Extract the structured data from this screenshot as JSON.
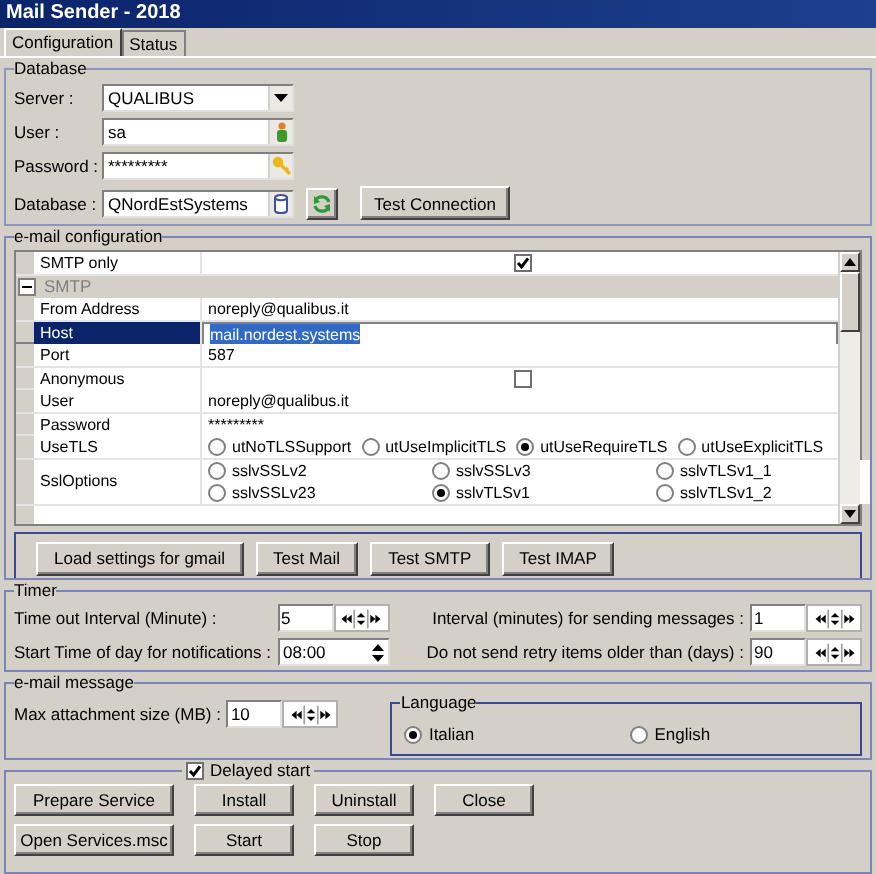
{
  "window": {
    "title": "Mail Sender - 2018"
  },
  "tabs": [
    {
      "label": "Configuration",
      "selected": true
    },
    {
      "label": "Status",
      "selected": false
    }
  ],
  "database": {
    "title": "Database",
    "fields": [
      {
        "label": "Server :",
        "value": "QUALIBUS",
        "kind": "dropdown"
      },
      {
        "label": "User :",
        "value": "sa",
        "kind": "user"
      },
      {
        "label": "Password :",
        "value": "*********",
        "kind": "password"
      },
      {
        "label": "Database :",
        "value": "QNordEstSystems",
        "kind": "database"
      }
    ],
    "test_button": "Test Connection"
  },
  "email_configuration": {
    "title": "e-mail configuration",
    "rows": [
      {
        "kind": "check",
        "label": "SMTP only",
        "checked": true
      },
      {
        "kind": "category",
        "label": "SMTP",
        "expanded": true
      },
      {
        "kind": "text",
        "label": "From Address",
        "value": "noreply@qualibus.it"
      },
      {
        "kind": "text",
        "label": "Host",
        "value": "mail.nordest.systems",
        "selected": true
      },
      {
        "kind": "text",
        "label": "Port",
        "value": "587"
      },
      {
        "kind": "check",
        "label": "Anonymous",
        "checked": false
      },
      {
        "kind": "text",
        "label": "User",
        "value": "noreply@qualibus.it"
      },
      {
        "kind": "text",
        "label": "Password",
        "value": "*********"
      },
      {
        "kind": "radio",
        "label": "UseTLS",
        "options": [
          {
            "label": "utNoTLSSupport",
            "selected": false
          },
          {
            "label": "utUseImplicitTLS",
            "selected": false
          },
          {
            "label": "utUseRequireTLS",
            "selected": true
          },
          {
            "label": "utUseExplicitTLS",
            "selected": false
          }
        ]
      },
      {
        "kind": "radio",
        "label": "SslOptions",
        "options": [
          {
            "label": "sslvSSLv2",
            "selected": false
          },
          {
            "label": "sslvSSLv3",
            "selected": false
          },
          {
            "label": "sslvTLSv1_1",
            "selected": false
          },
          {
            "label": "sslvSSLv23",
            "selected": false
          },
          {
            "label": "sslvTLSv1",
            "selected": true
          },
          {
            "label": "sslvTLSv1_2",
            "selected": false
          }
        ]
      }
    ],
    "buttons": [
      "Load settings for gmail",
      "Test Mail",
      "Test SMTP",
      "Test IMAP"
    ]
  },
  "timer": {
    "title": "Timer",
    "fields": [
      {
        "label": "Time out Interval (Minute) :",
        "value": "5",
        "kind": "spin"
      },
      {
        "label": "Interval (minutes) for sending messages :",
        "value": "1",
        "kind": "spin"
      },
      {
        "label": "Start Time of day for notifications :",
        "value": "08:00",
        "kind": "time"
      },
      {
        "label": "Do not send retry items older than (days) :",
        "value": "90",
        "kind": "spin"
      }
    ]
  },
  "email_message": {
    "title": "e-mail message",
    "max_attachment": {
      "label": "Max attachment size (MB) :",
      "value": "10"
    },
    "language": {
      "title": "Language",
      "options": [
        {
          "label": "Italian",
          "selected": true
        },
        {
          "label": "English",
          "selected": false
        }
      ]
    }
  },
  "service": {
    "delayed_start": {
      "label": "Delayed start",
      "checked": true
    },
    "buttons": [
      "Prepare Service",
      "Install",
      "Uninstall",
      "Close",
      "Open Services.msc",
      "Start",
      "Stop"
    ]
  }
}
